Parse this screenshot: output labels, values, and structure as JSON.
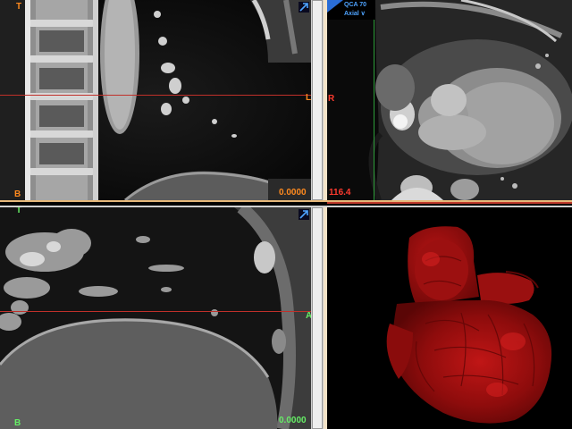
{
  "viewports": {
    "coronal": {
      "orientation_top": "T",
      "orientation_bottom": "B",
      "orientation_right": "L",
      "value": "0.0000",
      "icon": "expand-arrow-icon"
    },
    "axial": {
      "orientation_left": "R",
      "value": "116.4",
      "qca_label": "QCA 70",
      "view_select": "Axial ∨",
      "icon": "view-flag-icon"
    },
    "sagittal": {
      "orientation_top": "T",
      "orientation_bottom": "B",
      "orientation_right": "A",
      "value": "0.0000",
      "icon": "expand-arrow-icon"
    },
    "volume": {
      "render": "3d-heart-volume-render"
    }
  },
  "colors": {
    "crosshair_red": "#c0302a",
    "crosshair_green": "#2e9e3a",
    "label_orange": "#ff8a1e",
    "label_red": "#ff3b2f",
    "label_green": "#66ee66",
    "accent_blue": "#4ea3ff",
    "volume_red": "#a01010"
  }
}
